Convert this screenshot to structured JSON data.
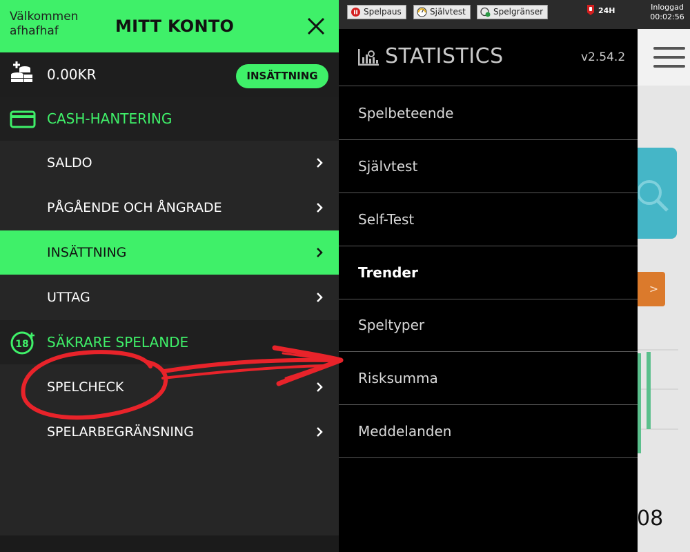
{
  "account_panel": {
    "welcome_line1": "Välkommen",
    "welcome_line2": "afhafhaf",
    "title": "MITT KONTO",
    "balance": "0.00KR",
    "deposit_button": "INSÄTTNING",
    "cash_section": "CASH-HANTERING",
    "cash_items": [
      {
        "label": "SALDO",
        "active": false
      },
      {
        "label": "PÅGÅENDE OCH ÅNGRADE",
        "active": false
      },
      {
        "label": "INSÄTTNING",
        "active": true
      },
      {
        "label": "UTTAG",
        "active": false
      }
    ],
    "safe_section": "SÄKRARE SPELANDE",
    "safe_items": [
      {
        "label": "SPELCHECK"
      },
      {
        "label": "SPELARBEGRÄNSNING"
      }
    ]
  },
  "top_bar": {
    "buttons": [
      {
        "label": "Spelpaus",
        "icon": "stop-circle-icon"
      },
      {
        "label": "Självtest",
        "icon": "gauge-icon"
      },
      {
        "label": "Spelgränser",
        "icon": "limits-icon"
      }
    ],
    "limit_label": "24H",
    "login_label": "Inloggad",
    "login_time": "00:02:56"
  },
  "statistics_menu": {
    "title": "STATISTICS",
    "version": "v2.54.2",
    "items": [
      {
        "label": "Spelbeteende",
        "bold": false
      },
      {
        "label": "Självtest",
        "bold": false
      },
      {
        "label": "Self-Test",
        "bold": false
      },
      {
        "label": "Trender",
        "bold": true
      },
      {
        "label": "Speltyper",
        "bold": false
      },
      {
        "label": "Risksumma",
        "bold": false
      },
      {
        "label": "Meddelanden",
        "bold": false
      }
    ]
  },
  "background_page": {
    "big_number": "08"
  },
  "colors": {
    "accent_green": "#3ff069",
    "panel_dark": "#262626",
    "annotation_red": "#e8232a"
  }
}
